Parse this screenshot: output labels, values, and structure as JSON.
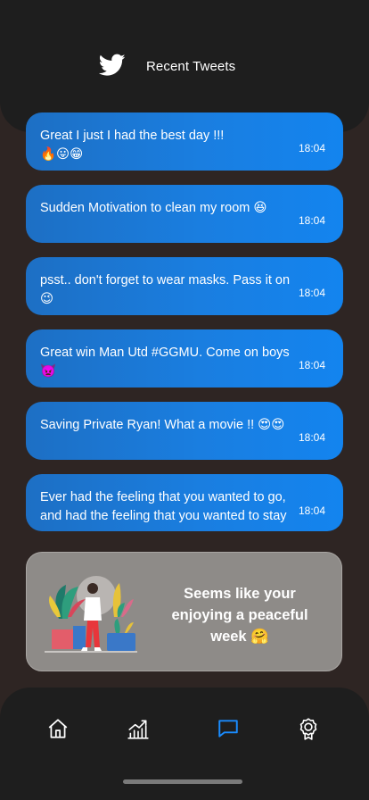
{
  "header": {
    "title": "Recent Tweets",
    "logo_icon": "twitter-bird-icon"
  },
  "tweets": [
    {
      "text": "Great I just I had the best day !!!",
      "emoji": "🔥😛😁",
      "time": "18:04"
    },
    {
      "text": "Sudden Motivation to clean my room 😆",
      "time": "18:04"
    },
    {
      "text": "psst.. don't forget to wear masks. Pass it on 😉",
      "time": "18:04"
    },
    {
      "text": "Great win Man Utd #GGMU. Come on boys 👿",
      "time": "18:04"
    },
    {
      "text": "Saving Private Ryan! What a movie !! 😍😍",
      "time": "18:04"
    },
    {
      "text": "Ever had the feeling that you wanted to go, and had the feeling that you wanted to stay",
      "time": "18:04"
    }
  ],
  "card": {
    "message": "Seems like your enjoying a peaceful week 🤗"
  },
  "nav": {
    "items": [
      {
        "icon": "home-icon",
        "active": false
      },
      {
        "icon": "stats-icon",
        "active": false
      },
      {
        "icon": "chat-icon",
        "active": true
      },
      {
        "icon": "award-icon",
        "active": false
      }
    ],
    "active_color": "#1a8cff",
    "inactive_color": "#ffffff"
  },
  "colors": {
    "background": "#2e2523",
    "panel": "#1e1e1e",
    "tweet_blue": "#1a7ee0",
    "card_gray": "#8e8b88"
  }
}
